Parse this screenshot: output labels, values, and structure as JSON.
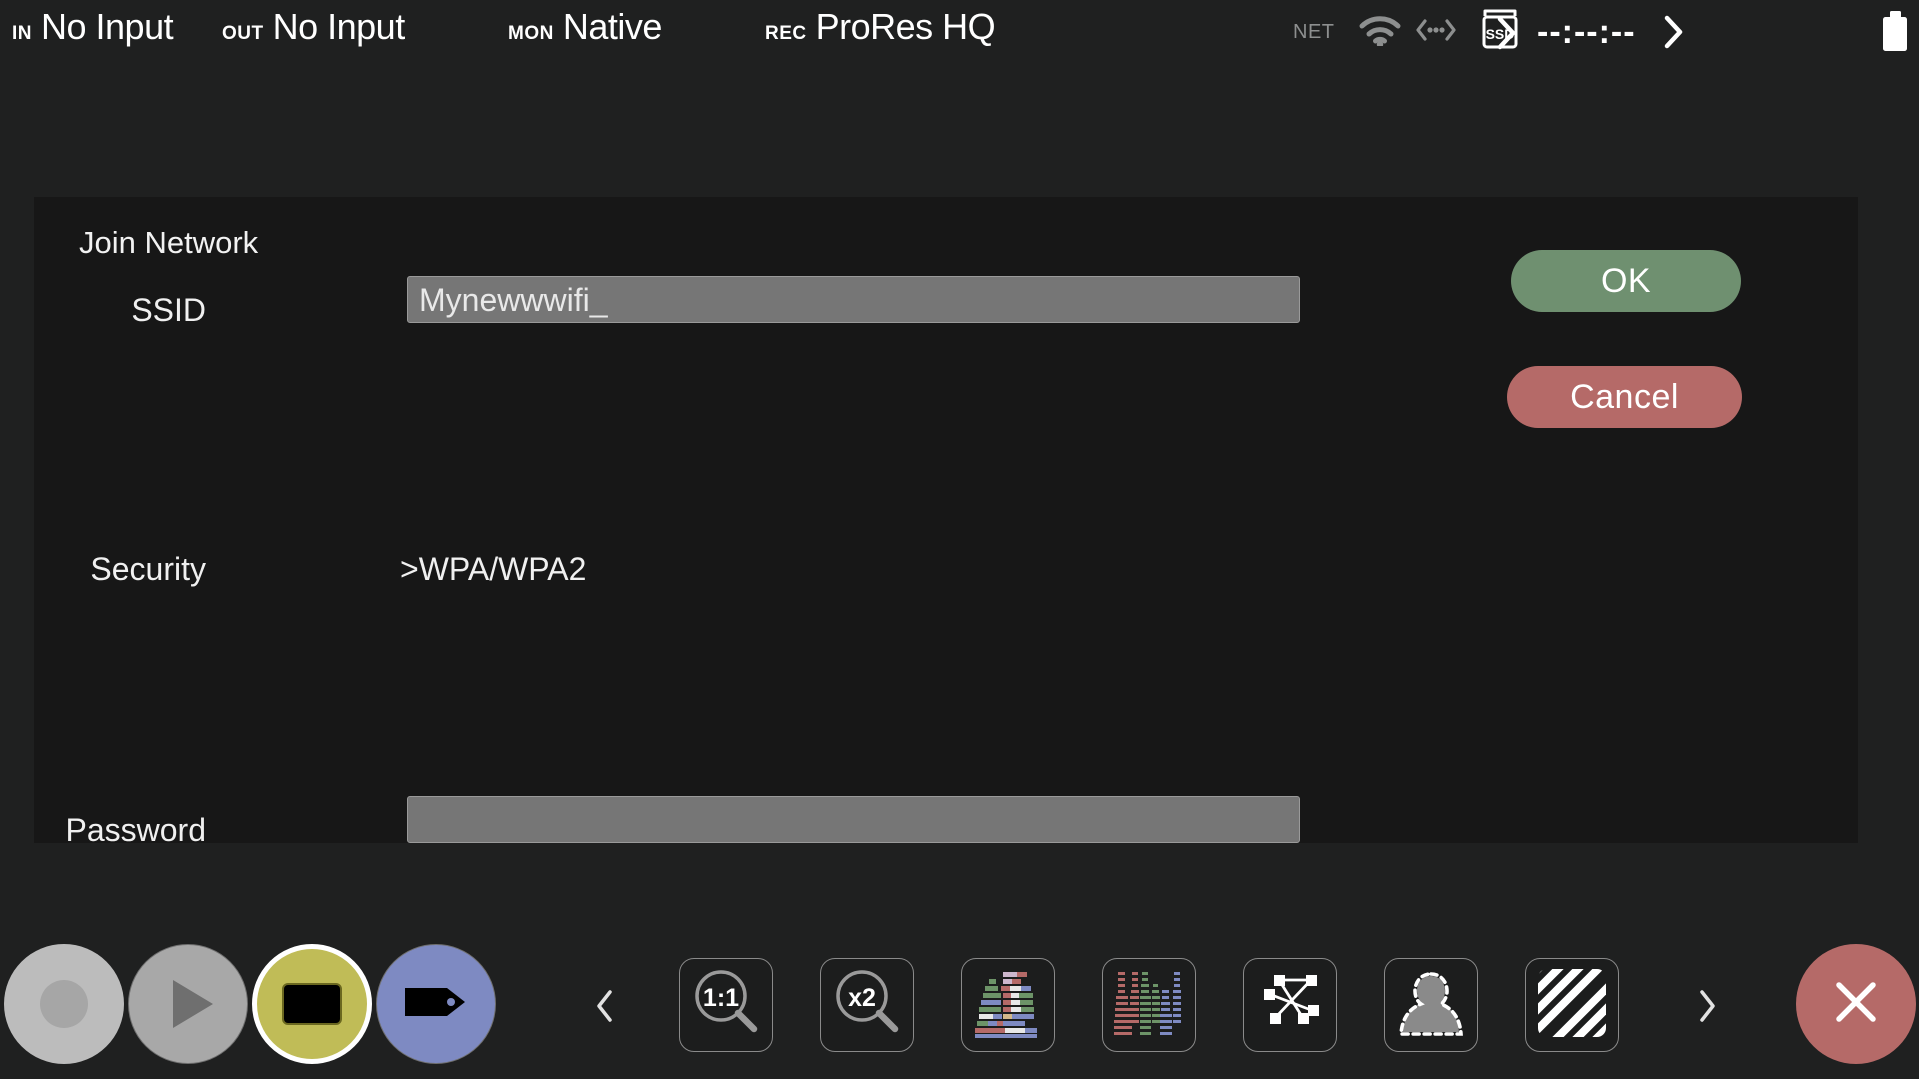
{
  "statusbar": {
    "input": {
      "key": "IN",
      "value": "No Input"
    },
    "output": {
      "key": "OUT",
      "value": "No Input"
    },
    "monitor": {
      "key": "MON",
      "value": "Native"
    },
    "record": {
      "key": "REC",
      "value": "ProRes HQ"
    },
    "network": {
      "key": "NET",
      "wifi_icon": "wifi-icon",
      "ethernet_icon": "ethernet-icon",
      "chevron_icon": "chevron-right-icon"
    },
    "media": {
      "label": "SSD",
      "timecode": "--:--:--",
      "drive_icon": "ssd-drive-icon",
      "chevron_icon": "chevron-right-icon"
    },
    "battery": {
      "icon": "battery-icon"
    }
  },
  "dialog": {
    "title": "Join Network",
    "rows": [
      {
        "label": "SSID",
        "type": "text",
        "value": "Mynewwwifi_",
        "placeholder": ""
      },
      {
        "label": "Security",
        "type": "select",
        "value": ">WPA/WPA2"
      },
      {
        "label": "Password",
        "type": "text",
        "value": "",
        "placeholder": ""
      }
    ],
    "buttons": {
      "ok": {
        "label": "OK",
        "color": "#6f9070"
      },
      "cancel": {
        "label": "Cancel",
        "color": "#b56a68"
      }
    }
  },
  "toolbar": {
    "transport": [
      {
        "name": "record-button",
        "icon": "record-dot-icon",
        "color": "#bcbcbc",
        "selected": false
      },
      {
        "name": "play-button",
        "icon": "play-triangle-icon",
        "color": "#a8a8a8",
        "selected": false
      },
      {
        "name": "monitor-button",
        "icon": "monitor-rect-icon",
        "color": "#c0bc57",
        "selected": true
      },
      {
        "name": "tag-button",
        "icon": "tag-icon",
        "color": "#7e8ac2",
        "selected": false
      }
    ],
    "prev_icon": "chevron-left-icon",
    "next_icon": "chevron-right-icon",
    "tools": [
      {
        "name": "zoom-1-1-tool",
        "icon": "magnifier-1-1-icon",
        "label": "1:1"
      },
      {
        "name": "zoom-x2-tool",
        "icon": "magnifier-x2-icon",
        "label": "x2"
      },
      {
        "name": "histogram-tool",
        "icon": "histogram-icon",
        "label": ""
      },
      {
        "name": "rgb-parade-tool",
        "icon": "rgb-parade-icon",
        "label": ""
      },
      {
        "name": "vectorscope-tool",
        "icon": "vectorscope-icon",
        "label": ""
      },
      {
        "name": "focus-peaking-tool",
        "icon": "focus-person-icon",
        "label": ""
      },
      {
        "name": "false-color-tool",
        "icon": "zebra-stripes-icon",
        "label": ""
      }
    ],
    "close": {
      "name": "close-button",
      "icon": "close-x-icon",
      "color": "#b56a68"
    }
  },
  "colors": {
    "background": "#1f2020",
    "panel": "#171717",
    "field": "#767676",
    "accent_ok": "#6f9070",
    "accent_cancel": "#b56a68",
    "selected_ring": "#ffffff"
  }
}
